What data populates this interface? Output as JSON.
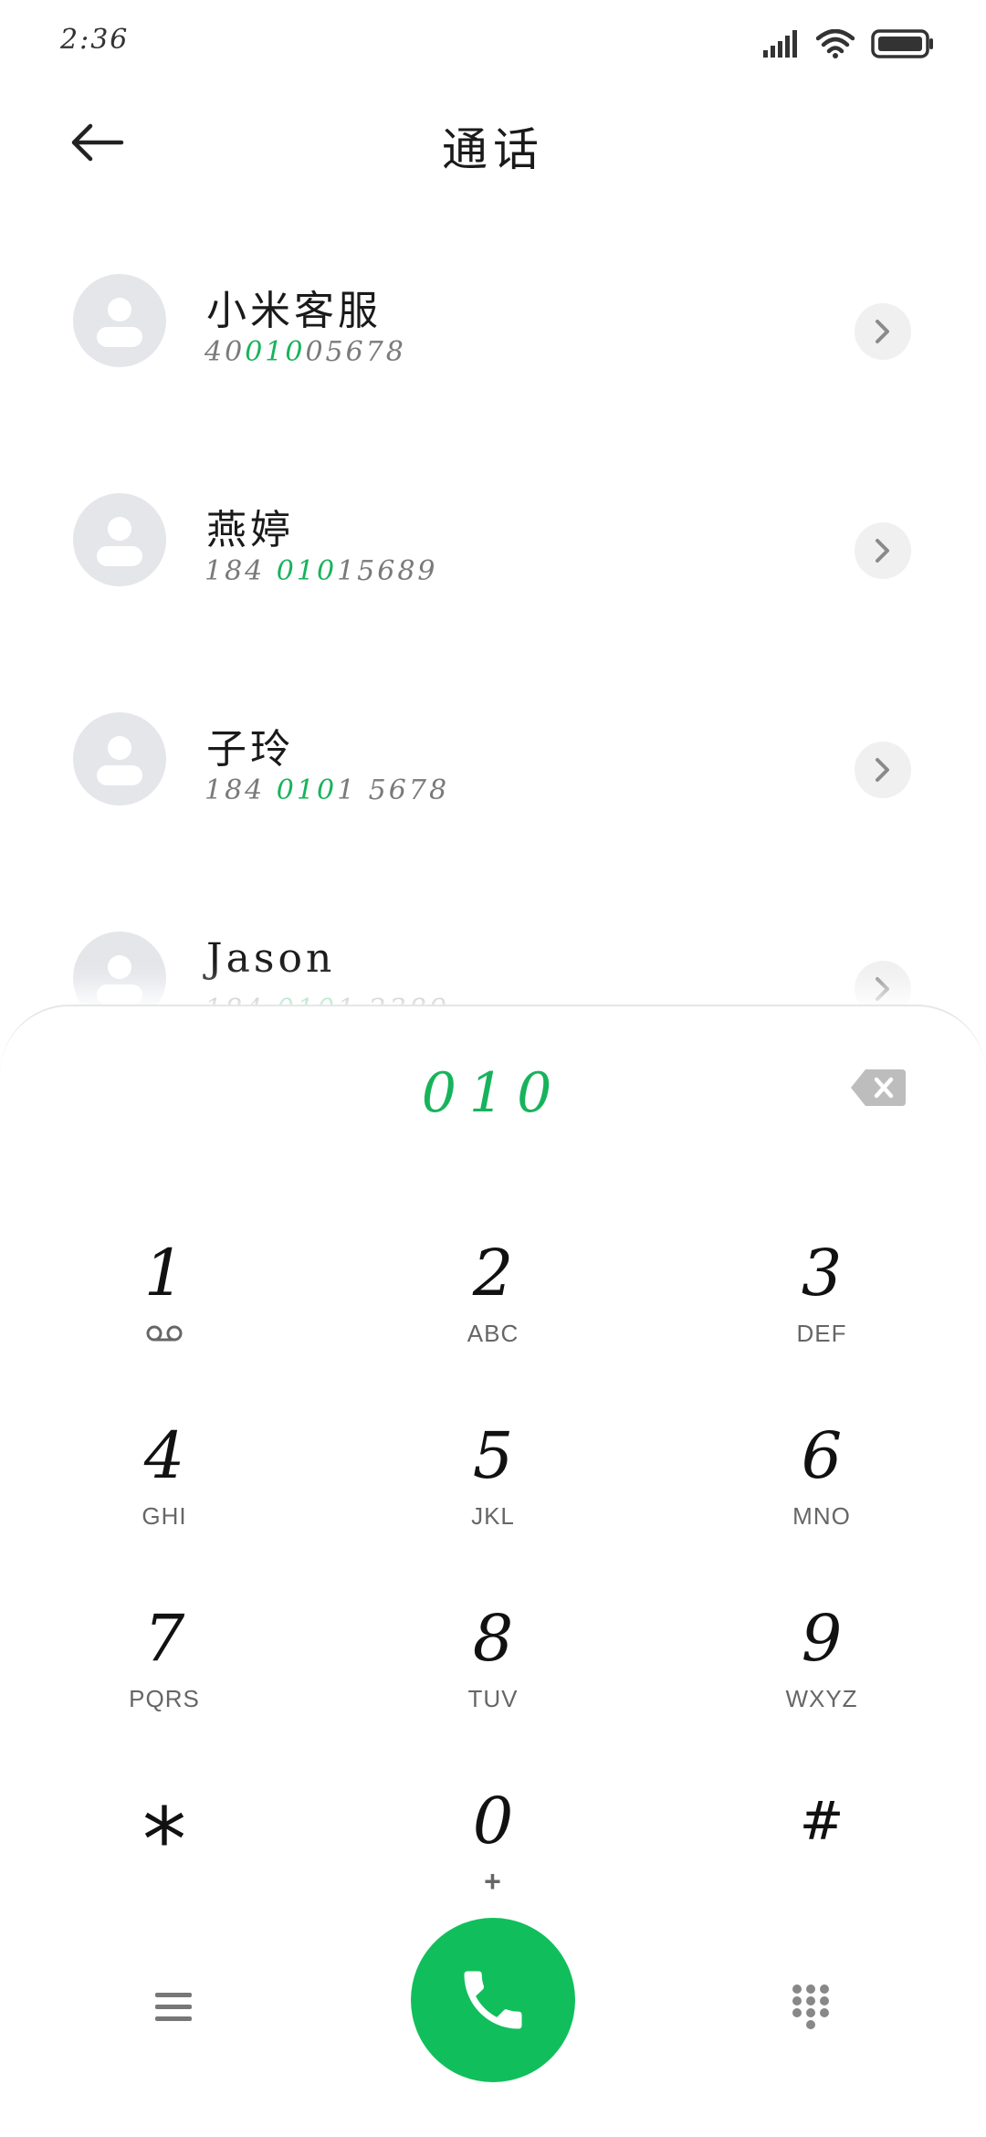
{
  "status_bar": {
    "time": "2:36",
    "icons": [
      "signal-icon",
      "wifi-icon",
      "battery-icon"
    ]
  },
  "header": {
    "title": "通话",
    "back_icon": "arrow-left-icon"
  },
  "contacts": [
    {
      "name": "小米客服",
      "number_pre": "40",
      "number_match": "010",
      "number_post": "05678"
    },
    {
      "name": "燕婷",
      "number_pre": "184 ",
      "number_match": "010",
      "number_post": "15689"
    },
    {
      "name": "子玲",
      "number_pre": "184 ",
      "number_match": "010",
      "number_post": "1 5678"
    },
    {
      "name": "Jason",
      "number_pre": "184 ",
      "number_match": "010",
      "number_post": "1 2389"
    }
  ],
  "dialer": {
    "input_value": "010",
    "keys": [
      {
        "digit": "1",
        "letters": "",
        "sub_icon": "voicemail-icon"
      },
      {
        "digit": "2",
        "letters": "ABC"
      },
      {
        "digit": "3",
        "letters": "DEF"
      },
      {
        "digit": "4",
        "letters": "GHI"
      },
      {
        "digit": "5",
        "letters": "JKL"
      },
      {
        "digit": "6",
        "letters": "MNO"
      },
      {
        "digit": "7",
        "letters": "PQRS"
      },
      {
        "digit": "8",
        "letters": "TUV"
      },
      {
        "digit": "9",
        "letters": "WXYZ"
      },
      {
        "digit": "*",
        "letters": ""
      },
      {
        "digit": "0",
        "letters": "+"
      },
      {
        "digit": "#",
        "letters": ""
      }
    ]
  },
  "bottom_bar": {
    "menu_icon": "menu-icon",
    "call_icon": "phone-icon",
    "dialpad_icon": "dialpad-icon"
  },
  "colors": {
    "accent": "#10bf5b",
    "highlight": "#17b35b",
    "avatar_bg": "#e4e6ea"
  }
}
